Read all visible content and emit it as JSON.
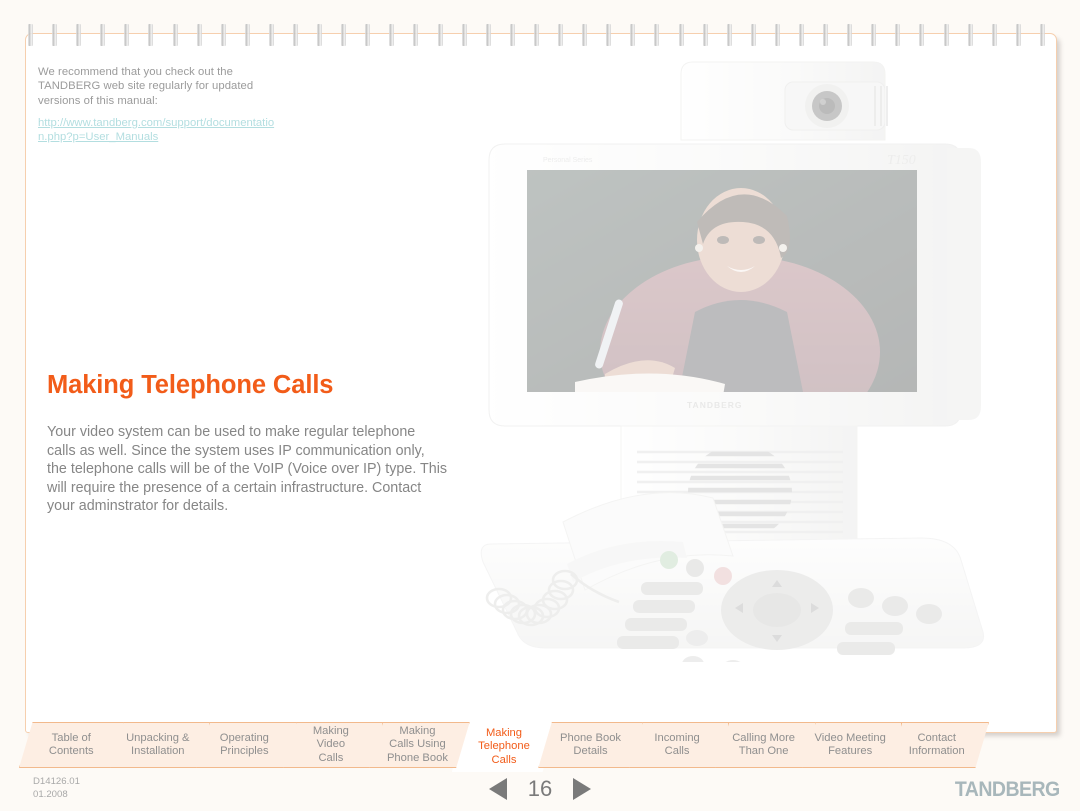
{
  "page": {
    "background_color": "#fdfaf6",
    "sheet_color": "#ffffff",
    "accent_color": "#f25c19",
    "border_color": "#f6cfae",
    "spiral_ring_count": 43
  },
  "intro_note": {
    "text": "We recommend that you check out the TANDBERG web site regularly for updated versions of this manual:",
    "link_text": "http://www.tandberg.com/support/documentation.php?p=User_Manuals",
    "link_color": "#b3dee0"
  },
  "main": {
    "title": "Making Telephone Calls",
    "body": "Your video system can be used to make regular telephone calls as well. Since the system uses IP communication only, the telephone calls will be of the VoIP (Voice over IP) type. This will require the presence of a certain infrastructure. Contact your adminstrator for details."
  },
  "product_photo": {
    "brand_label": "TANDBERG",
    "model_label": "T150",
    "series_label": "Personal Series"
  },
  "tabs": [
    {
      "label": "Table of\nContents",
      "active": false
    },
    {
      "label": "Unpacking &\nInstallation",
      "active": false
    },
    {
      "label": "Operating\nPrinciples",
      "active": false
    },
    {
      "label": "Making\nVideo\nCalls",
      "active": false
    },
    {
      "label": "Making\nCalls Using\nPhone Book",
      "active": false
    },
    {
      "label": "Making\nTelephone\nCalls",
      "active": true
    },
    {
      "label": "Phone Book\nDetails",
      "active": false
    },
    {
      "label": "Incoming\nCalls",
      "active": false
    },
    {
      "label": "Calling More\nThan One",
      "active": false
    },
    {
      "label": "Video Meeting\nFeatures",
      "active": false
    },
    {
      "label": "Contact\nInformation",
      "active": false
    }
  ],
  "footer": {
    "doc_id": "D14126.01",
    "doc_date": "01.2008",
    "page_number": "16",
    "prev_label": "Previous page",
    "next_label": "Next page",
    "brand": "TANDBERG"
  }
}
